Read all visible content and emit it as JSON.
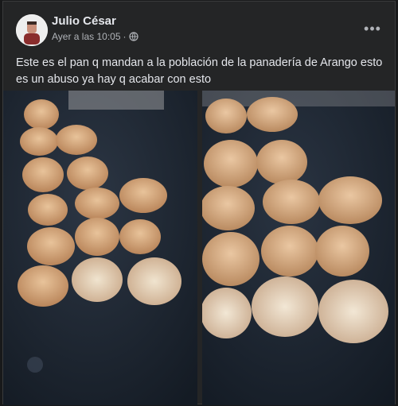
{
  "post": {
    "author": "Julio César",
    "timestamp": "Ayer a las 10:05",
    "separator": "·",
    "privacy_icon": "globe-icon",
    "more_icon": "more-options-icon",
    "text": "Este es el pan q mandan a la población de la panadería de Arango esto es un abuso ya hay q acabar con esto"
  },
  "photos": [
    {
      "description": "photo-left"
    },
    {
      "description": "photo-right"
    }
  ],
  "colors": {
    "background": "#242526",
    "text_primary": "#e4e6eb",
    "text_secondary": "#b0b3b8",
    "table": "#1f2733",
    "bread": "#d7a77b"
  }
}
